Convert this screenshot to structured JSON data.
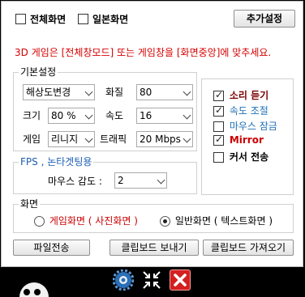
{
  "top": {
    "fullscreen_label": "전체화면",
    "fullscreen_checked": false,
    "normal_label": "일본화면",
    "normal_checked": false,
    "add_settings_button": "추가설정"
  },
  "notice": "3D 게임은 [전체창모드] 또는 게임창을 [화면중앙]에 맞추세요.",
  "notice_color": "#d40000",
  "basic": {
    "legend": "기본설정",
    "resolution_select": "해상도변경",
    "quality_label": "화질",
    "quality_value": "80",
    "size_label": "크기",
    "size_value": "80 %",
    "speed_label": "속도",
    "speed_value": "16",
    "game_label": "게임",
    "game_value": "리니지",
    "traffic_label": "트래픽",
    "traffic_value": "20 Mbps"
  },
  "options": [
    {
      "label": "소리 듣기",
      "checked": true,
      "color": "#7a0000"
    },
    {
      "label": "속도 조절",
      "checked": true,
      "color": "#1b6fb5"
    },
    {
      "label": "마우스 잠금",
      "checked": false,
      "color": "#1b6fb5"
    },
    {
      "label": "Mirror",
      "checked": true,
      "color": "#cc0000"
    },
    {
      "label": "커서 전송",
      "checked": false,
      "color": "#000000"
    }
  ],
  "fps": {
    "legend": "FPS , 논타겟팅용",
    "legend_color": "#1b5fb5",
    "sensitivity_label": "마우스 감도 :",
    "sensitivity_value": "2"
  },
  "screen": {
    "legend": "화면",
    "game_screen_label": "게임화면 ( 사진화면 )",
    "game_screen_color": "#cc0000",
    "game_screen_selected": false,
    "normal_screen_label": "일반화면 ( 텍스트화면 )",
    "normal_screen_selected": true
  },
  "buttons": {
    "file_transfer": "파일전송",
    "clipboard_send": "클립보드 보내기",
    "clipboard_get": "클립보드 가져오기"
  },
  "taskbar": {
    "icons": [
      "settings-gear-icon",
      "shrink-arrows-icon",
      "close-icon"
    ]
  }
}
